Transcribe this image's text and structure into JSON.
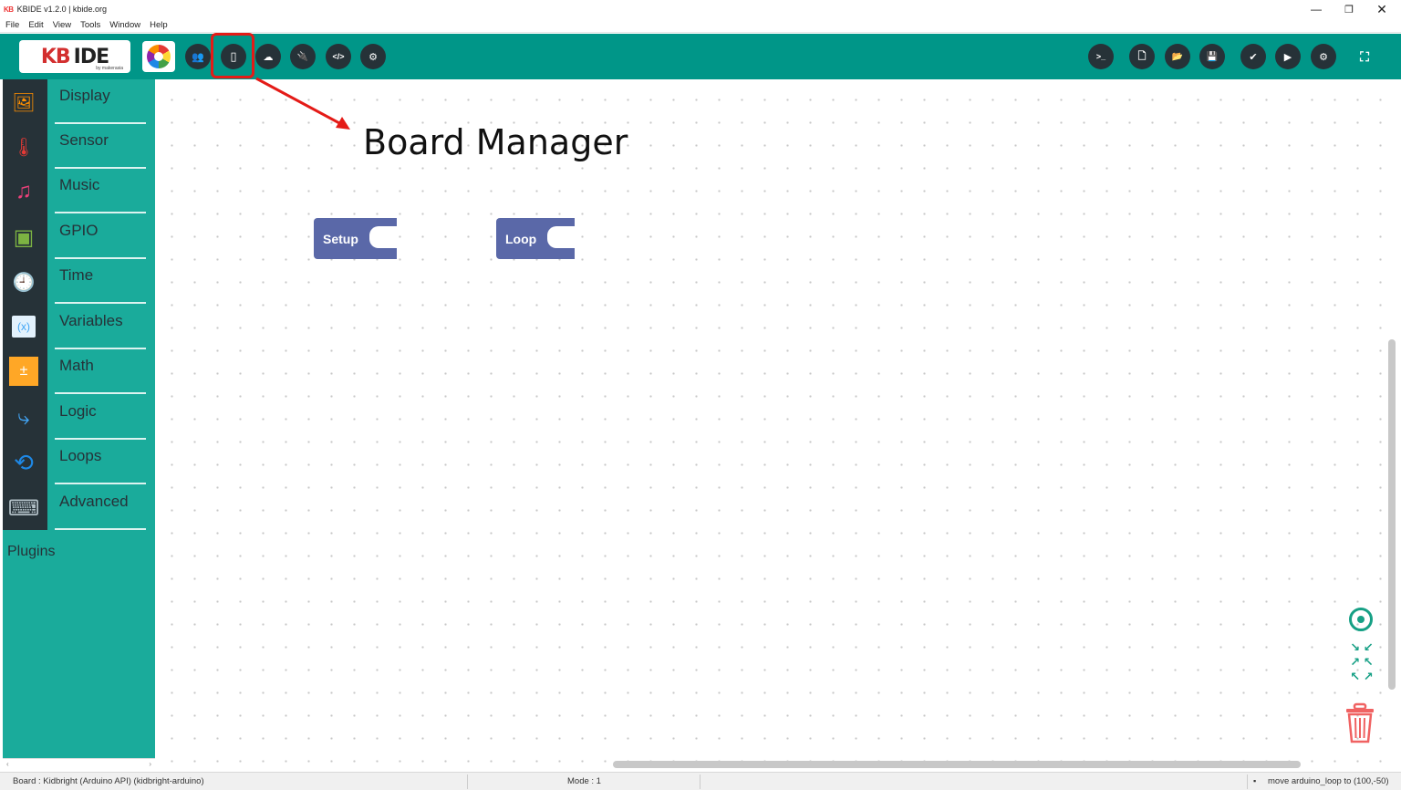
{
  "window": {
    "app_logo": "KB",
    "title": "KBIDE v1.2.0 | kbide.org",
    "controls": {
      "minimize": "—",
      "maximize": "❐",
      "close": "✕"
    }
  },
  "menu": [
    "File",
    "Edit",
    "View",
    "Tools",
    "Window",
    "Help"
  ],
  "toolbar": {
    "logo_main": "KB",
    "logo_ide": "IDE",
    "logo_sub": "by makerasia",
    "left_buttons": [
      {
        "icon": "team-icon",
        "glyph": "👥"
      },
      {
        "icon": "board-manager-icon",
        "glyph": "▯"
      },
      {
        "icon": "plugins-icon",
        "glyph": "☁"
      },
      {
        "icon": "plug-icon",
        "glyph": "🔌"
      },
      {
        "icon": "code-icon",
        "glyph": "</>"
      },
      {
        "icon": "gear-icon",
        "glyph": "⚙"
      }
    ],
    "right_buttons": [
      {
        "icon": "terminal-icon",
        "glyph": ">_"
      },
      {
        "icon": "new-file-icon",
        "glyph": "🗋"
      },
      {
        "icon": "open-folder-icon",
        "glyph": "📂"
      },
      {
        "icon": "save-icon",
        "glyph": "💾"
      },
      {
        "icon": "compile-check-icon",
        "glyph": "✔"
      },
      {
        "icon": "run-icon",
        "glyph": "▶"
      },
      {
        "icon": "settings-gears-icon",
        "glyph": "⚙"
      },
      {
        "icon": "fullscreen-icon",
        "glyph": "⛶"
      }
    ]
  },
  "sidebar": {
    "categories": [
      {
        "label": "Display",
        "icon": "display-icon",
        "glyph": "🖼",
        "color": "#ff8f00"
      },
      {
        "label": "Sensor",
        "icon": "thermometer-icon",
        "glyph": "🌡",
        "color": "#e53935"
      },
      {
        "label": "Music",
        "icon": "music-note-icon",
        "glyph": "♫",
        "color": "#ec407a"
      },
      {
        "label": "GPIO",
        "icon": "chip-icon",
        "glyph": "▣",
        "color": "#7cb342"
      },
      {
        "label": "Time",
        "icon": "clock-icon",
        "glyph": "🕘",
        "color": "#9575cd"
      },
      {
        "label": "Variables",
        "icon": "variables-icon",
        "glyph": "(x)",
        "color": "#42a5f5"
      },
      {
        "label": "Math",
        "icon": "math-icon",
        "glyph": "±",
        "color": "#ffa726"
      },
      {
        "label": "Logic",
        "icon": "logic-icon",
        "glyph": "⤷",
        "color": "#42a5f5"
      },
      {
        "label": "Loops",
        "icon": "loops-icon",
        "glyph": "⟲",
        "color": "#1e88e5"
      },
      {
        "label": "Advanced",
        "icon": "advanced-icon",
        "glyph": "⌨",
        "color": "#b0bec5"
      }
    ],
    "plugins_label": "Plugins",
    "scroll_left": "‹",
    "scroll_right": "›"
  },
  "workspace": {
    "blocks": {
      "setup": "Setup",
      "loop": "Loop"
    },
    "annotation": "Board Manager",
    "zoom_arrows": [
      "↘ ↙",
      "↗ ↖",
      "↖ ↗",
      "↙ ↘"
    ]
  },
  "status": {
    "board": "Board : Kidbright (Arduino API) (kidbright-arduino)",
    "mode": "Mode : 1",
    "message": "move arduino_loop to (100,-50)"
  },
  "colors": {
    "toolbar": "#009688",
    "sidebar": "#1aab9b",
    "block": "#5a68a8",
    "highlight": "#e41b17"
  }
}
